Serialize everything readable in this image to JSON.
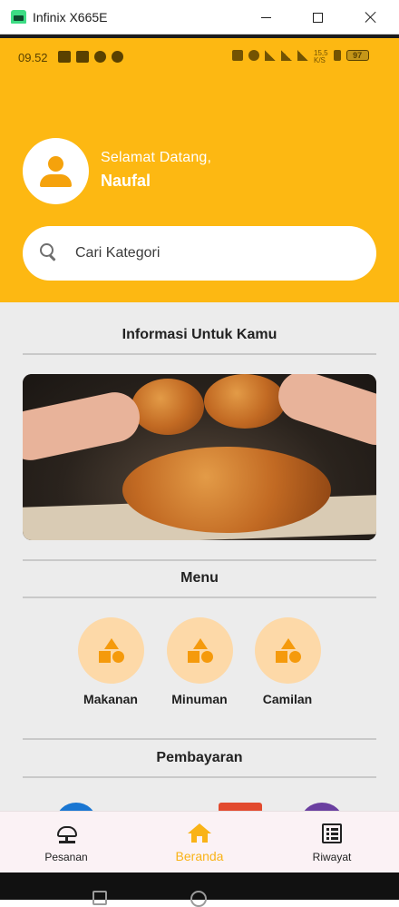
{
  "window": {
    "title": "Infinix X665E"
  },
  "status_bar": {
    "time": "09.52",
    "speed_top": "15,5",
    "speed_unit": "K/S",
    "battery": "97"
  },
  "header": {
    "greeting": "Selamat Datang,",
    "username": "Naufal"
  },
  "search": {
    "placeholder": "Cari Kategori",
    "icon": "search-icon"
  },
  "sections": {
    "info_title": "Informasi Untuk Kamu",
    "menu_title": "Menu",
    "payment_title": "Pembayaran"
  },
  "menu": {
    "items": [
      {
        "label": "Makanan",
        "icon": "category-shapes-icon"
      },
      {
        "label": "Minuman",
        "icon": "category-shapes-icon"
      },
      {
        "label": "Camilan",
        "icon": "category-shapes-icon"
      }
    ]
  },
  "bottom_nav": {
    "items": [
      {
        "label": "Pesanan",
        "icon": "food-tray-icon",
        "active": false
      },
      {
        "label": "Beranda",
        "icon": "home-icon",
        "active": true
      },
      {
        "label": "Riwayat",
        "icon": "list-icon",
        "active": false
      }
    ]
  },
  "colors": {
    "brand_yellow": "#fdb812",
    "active_nav": "#f9b317",
    "category_circle": "#fdd9a8",
    "category_icon": "#f59a0c",
    "content_bg": "#ececec"
  }
}
